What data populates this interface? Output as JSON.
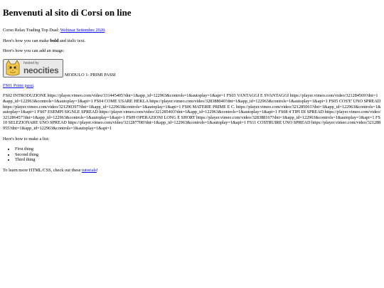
{
  "page": {
    "title": "Benvenuti al sito di Corsi on line",
    "intro_prefix": "Corso Relax Trading Top Dual: ",
    "intro_link": "Webinar Settembre 2020",
    "intro_suffix": ".",
    "format_prefix": "Here's how you can make ",
    "format_bold": "bold",
    "format_middle": " and ",
    "format_italic": "italic",
    "format_suffix": " text.",
    "image_intro": "Here's how you can add an image:",
    "badge_small": "hosted by",
    "badge_big": "neocities",
    "image_caption": "MODULO 1- PRIMI PASSI",
    "fs01_link": "FS01 Primi passi",
    "fs01_suffix": ".",
    "vimeo_text": "FS02 INTRODUZIONE https://player.vimeo.com/video/331445405?dnt=1&app_id=122963&controls=1&autoplay=1&api=1 FS03 VANTAGGI E SVANTAGGI https://player.vimeo.com/video/321284569?dnt=1&app_id=122963&controls=1&autoplay=1&api=1 FS04 COME USARE HEKLA https://player.vimeo.com/video/328388040?dnt=1&app_id=122963&controls=1&autoplay=1&api=1 FS05 COS'E' UNO SPREAD https://player.vimeo.com/video/321290397?dnt=1&app_id=122963&controls=1&autoplay=1&api=1 FS06 MATERIE PRIME E C. https://player.vimeo.com/video/321285061?dnt=1&app_id=122963&controls=1&autoplay=1&api=1 FS07 ESEMPI SIGNLE SPREAD https://player.vimeo.com/video/321285403?dnt=1&app_id=122963&controls=1&autoplay=1&api=1 FS08 4 TIPI DI SPREAD https://player.vimeo.com/video/321286457?dnt=1&app_id=122963&controls=1&autoplay=1&api=1 FS09 OPERAZIONI LONG E SHORT https://player.vimeo.com/video/328388167?dnt=1&app_id=122963&controls=1&autoplay=1&api=1 FS10 SELEZIONARE UNO SPREAD https://player.vimeo.com/video/321287708?dnt=1&app_id=122963&controls=1&autoplay=1&api=1 FS11 COSTRUIRE UNO SPREAD https://player.vimeo.com/video/321288955?dnt=1&app_id=122963&controls=1&autoplay=1&api=1",
    "list_intro": "Here's how to make a list:",
    "list_items": [
      "First thing",
      "Second thing",
      "Third thing"
    ],
    "footer_prefix": "To learn more HTML/CSS, check out these ",
    "footer_link": "tutorials",
    "footer_suffix": "!"
  },
  "colors": {
    "link": "#0000ee",
    "text": "#000000",
    "background": "#ffffff"
  },
  "icons": {
    "badge": "neocities-cat-icon"
  }
}
